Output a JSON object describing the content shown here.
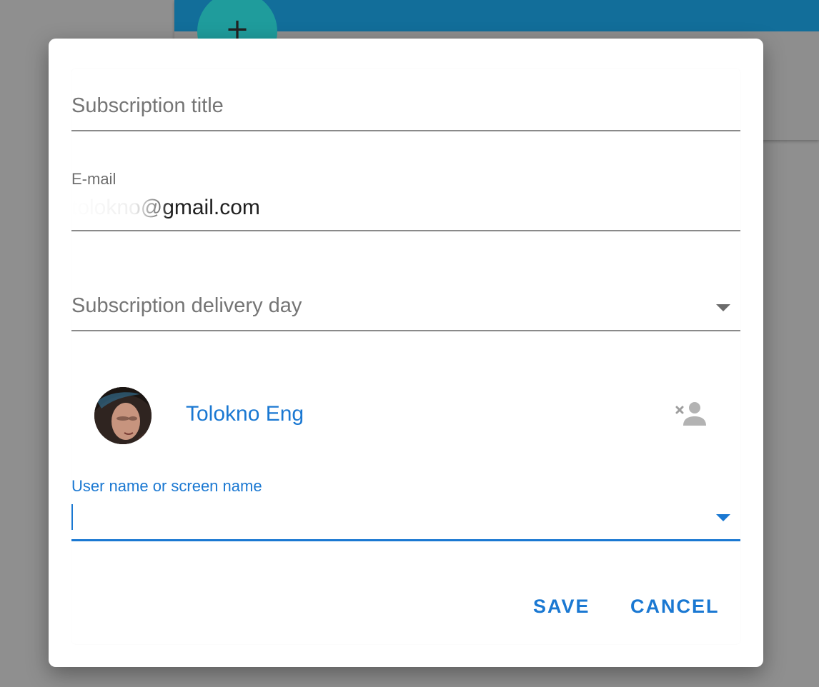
{
  "dialog": {
    "title_field": {
      "placeholder": "Subscription title",
      "value": ""
    },
    "email_field": {
      "label": "E-mail",
      "value": "tolokno@gmail.com"
    },
    "delivery_day_field": {
      "placeholder": "Subscription delivery day",
      "selected": ""
    },
    "selected_user": {
      "name": "Tolokno Eng",
      "avatar_icon": "user-photo",
      "remove_icon": "remove-user-icon"
    },
    "user_search_field": {
      "label": "User name or screen name",
      "value": ""
    },
    "buttons": {
      "save_label": "SAVE",
      "cancel_label": "CANCEL"
    }
  },
  "colors": {
    "accent": "#1a78d2",
    "appbar": "#126e9a",
    "fab": "#1f9c9c",
    "overlay": "#8f8f8f"
  }
}
